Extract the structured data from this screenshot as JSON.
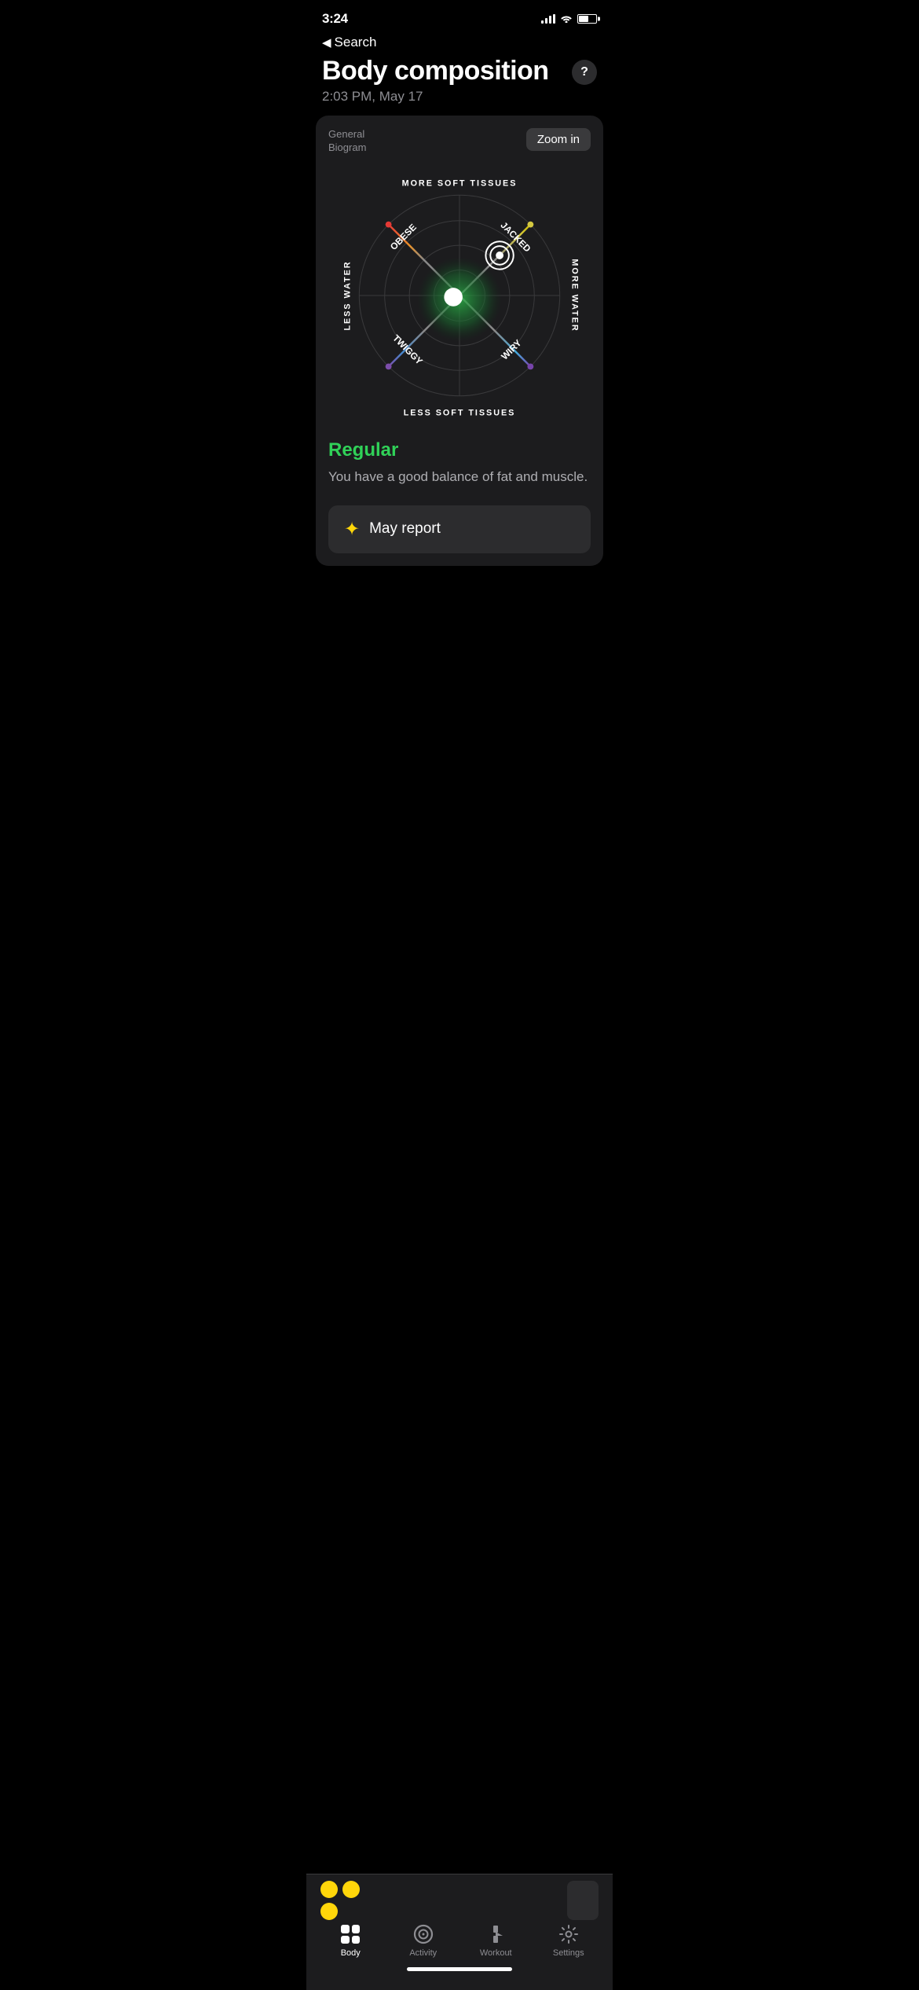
{
  "statusBar": {
    "time": "3:24",
    "locationIcon": "▶",
    "batteryLevel": 55
  },
  "header": {
    "backLabel": "Search",
    "title": "Body composition",
    "subtitle": "2:03 PM, May 17",
    "helpIcon": "?"
  },
  "biogram": {
    "label": "General\nBiogram",
    "zoomButton": "Zoom in",
    "labels": {
      "top": "MORE SOFT TISSUES",
      "bottom": "LESS SOFT TISSUES",
      "left": "LESS WATER",
      "right": "MORE WATER",
      "topLeft": "OBESE",
      "topRight": "JACKED",
      "bottomLeft": "TWIGGY",
      "bottomRight": "WIRY"
    }
  },
  "result": {
    "status": "Regular",
    "statusColor": "#30d158",
    "description": "You have a good balance of fat and muscle."
  },
  "reportButton": {
    "icon": "✦",
    "label": "May report"
  },
  "bottomNav": {
    "items": [
      {
        "id": "body",
        "label": "Body",
        "active": true
      },
      {
        "id": "activity",
        "label": "Activity",
        "active": false
      },
      {
        "id": "workout",
        "label": "Workout",
        "active": false
      },
      {
        "id": "settings",
        "label": "Settings",
        "active": false
      }
    ]
  }
}
